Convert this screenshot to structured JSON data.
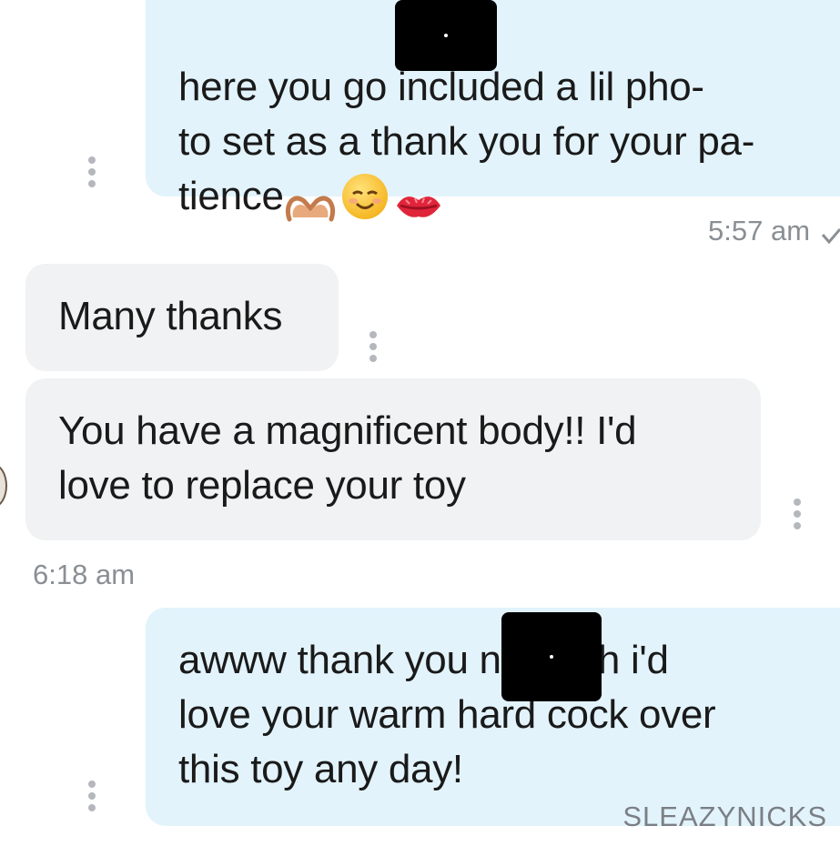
{
  "messages": [
    {
      "id": "m1",
      "direction": "outgoing",
      "text": "here you go        included a lil pho-\nto set as a thank you for your pa-\ntience",
      "emojis": [
        "hands-heart-icon",
        "smiling-face-icon",
        "kiss-mark-icon"
      ],
      "timestamp": "5:57 am",
      "status": "read-check-icon"
    },
    {
      "id": "m2",
      "direction": "incoming",
      "text": "Many thanks"
    },
    {
      "id": "m3",
      "direction": "incoming",
      "text": "You have a magnificent body!! I'd\nlove to replace your toy",
      "timestamp": "6:18 am"
    },
    {
      "id": "m4",
      "direction": "outgoing",
      "text": "awww thank you        nd gosh i'd\nlove your warm hard cock over\nthis toy any day!"
    }
  ],
  "watermark": "SLEAZYNICKS",
  "colors": {
    "outgoing_bubble": "#e2f3fb",
    "incoming_bubble": "#f1f2f3",
    "timestamp": "#8a8f94",
    "more_dots": "#b4b8bc"
  }
}
